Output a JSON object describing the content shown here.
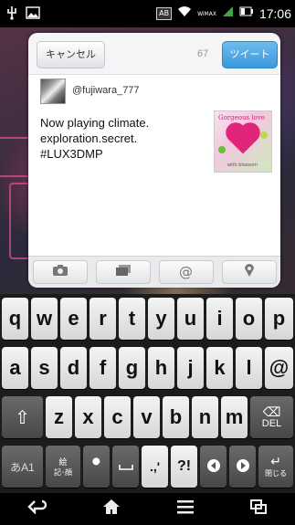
{
  "status_bar": {
    "left_icons": [
      "usb-icon",
      "image-icon"
    ],
    "badge": "AB",
    "network_label": "WiMAX",
    "time": "17:06"
  },
  "compose": {
    "cancel_label": "キャンセル",
    "char_count": "67",
    "tweet_label": "ツイート",
    "username": "@fujiwara_777",
    "text": "Now playing  climate.\nexploration.secret.\n#LUX3DMP",
    "thumbnail": {
      "title": "Gorgeous love",
      "caption": "with blossom"
    },
    "toolbar_icons": [
      "camera-icon",
      "gallery-icon",
      "at-icon",
      "location-icon"
    ]
  },
  "keyboard": {
    "row1": [
      "q",
      "w",
      "e",
      "r",
      "t",
      "y",
      "u",
      "i",
      "o",
      "p"
    ],
    "row2": [
      "a",
      "s",
      "d",
      "f",
      "g",
      "h",
      "j",
      "k",
      "l",
      "@"
    ],
    "row3_keys": [
      "z",
      "x",
      "c",
      "v",
      "b",
      "n",
      "m"
    ],
    "shift_symbol": "⇧",
    "delete_label": "DEL",
    "row4": {
      "mode_label": "あA1",
      "symbol_label_top": "絵",
      "symbol_label_bottom": "記･顔",
      "tool_symbol": "🔧",
      "space_symbol": "␣",
      "punct_label": ".,'",
      "qmark_label": "?!",
      "left_symbol": "◀",
      "right_symbol": "▶",
      "enter_label": "閉じる"
    }
  },
  "nav_bar": {
    "icons": [
      "back-icon",
      "home-icon",
      "menu-icon",
      "recent-apps-icon"
    ]
  }
}
